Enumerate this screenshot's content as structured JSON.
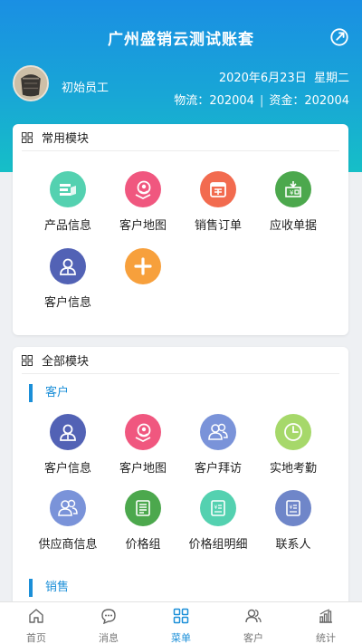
{
  "header": {
    "title": "广州盛销云测试账套",
    "user_name": "初始员工",
    "date": "2020年6月23日",
    "weekday": "星期二",
    "logistics_label": "物流：",
    "logistics_period": "202004",
    "funds_label": "资金：",
    "funds_period": "202004",
    "separator": "|"
  },
  "common_modules": {
    "title": "常用模块",
    "items": [
      {
        "label": "产品信息",
        "icon": "product-icon",
        "color": "#54d1b0"
      },
      {
        "label": "客户地图",
        "icon": "customer-map-icon",
        "color": "#f0577f"
      },
      {
        "label": "销售订单",
        "icon": "sales-order-icon",
        "color": "#f26b4f"
      },
      {
        "label": "应收单据",
        "icon": "receivable-icon",
        "color": "#4ca84d"
      },
      {
        "label": "客户信息",
        "icon": "customer-info-icon",
        "color": "#5262b5"
      },
      {
        "label": "",
        "icon": "add-icon",
        "color": "#f7a03c"
      }
    ]
  },
  "all_modules": {
    "title": "全部模块",
    "sections": [
      {
        "label": "客户",
        "items": [
          {
            "label": "客户信息",
            "icon": "customer-info-icon",
            "color": "#5262b5"
          },
          {
            "label": "客户地图",
            "icon": "customer-map-icon",
            "color": "#f0577f"
          },
          {
            "label": "客户拜访",
            "icon": "customer-visit-icon",
            "color": "#7a93d9"
          },
          {
            "label": "实地考勤",
            "icon": "attendance-icon",
            "color": "#a6d86a"
          },
          {
            "label": "供应商信息",
            "icon": "supplier-icon",
            "color": "#7a93d9"
          },
          {
            "label": "价格组",
            "icon": "price-group-icon",
            "color": "#4ca84d"
          },
          {
            "label": "价格组明细",
            "icon": "price-detail-icon",
            "color": "#54d1b0"
          },
          {
            "label": "联系人",
            "icon": "contact-icon",
            "color": "#6f86c9"
          }
        ]
      },
      {
        "label": "销售"
      }
    ]
  },
  "tabbar": {
    "items": [
      {
        "label": "首页",
        "icon": "home-icon"
      },
      {
        "label": "消息",
        "icon": "message-icon"
      },
      {
        "label": "菜单",
        "icon": "menu-icon",
        "active": true
      },
      {
        "label": "客户",
        "icon": "customer-icon"
      },
      {
        "label": "统计",
        "icon": "stats-icon"
      }
    ]
  },
  "colors": {
    "primary": "#1b8fd8",
    "header_top": "#1a8fe3",
    "header_bottom": "#16bfc7"
  }
}
